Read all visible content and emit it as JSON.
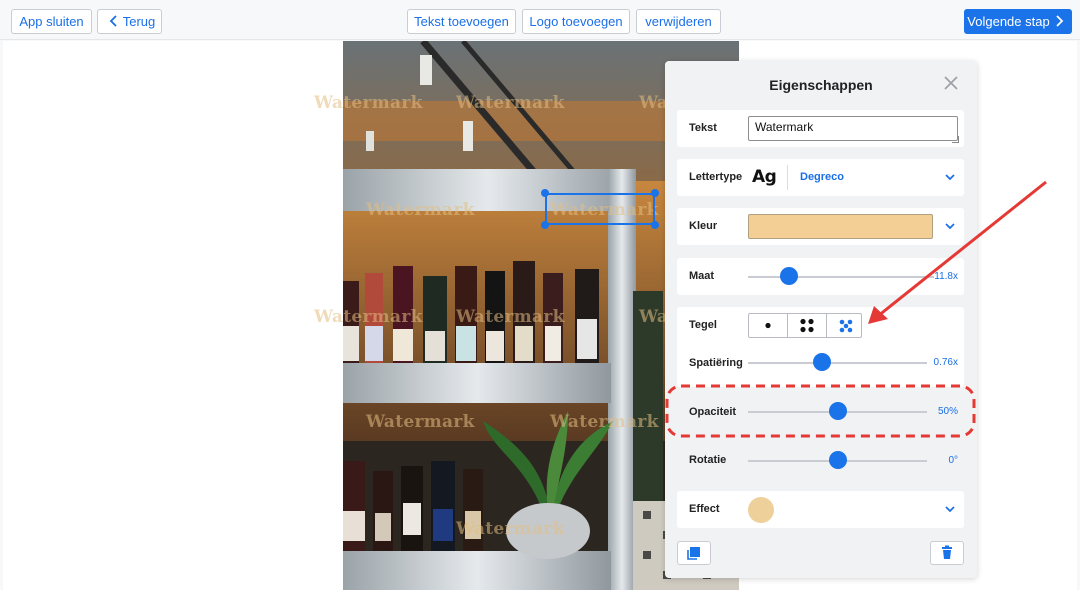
{
  "toolbar": {
    "close_app": "App sluiten",
    "back": "Terug",
    "add_text": "Tekst toevoegen",
    "add_logo": "Logo toevoegen",
    "delete": "verwijderen",
    "next_step": "Volgende stap"
  },
  "canvas": {
    "watermark_text": "Watermark"
  },
  "panel": {
    "title": "Eigenschappen",
    "text_label": "Tekst",
    "text_value": "Watermark",
    "font_label": "Lettertype",
    "font_preview": "Ag",
    "font_name": "Degreco",
    "color_label": "Kleur",
    "color_value": "#f3cf95",
    "size_label": "Maat",
    "size_value": "11.8x",
    "tile_label": "Tegel",
    "spacing_label": "Spatiëring",
    "spacing_value": "0.76x",
    "opacity_label": "Opaciteit",
    "opacity_value": "50%",
    "rotation_label": "Rotatie",
    "rotation_value": "0°",
    "effect_label": "Effect",
    "effect_color": "#eed09a"
  },
  "colors": {
    "accent": "#1a73e8",
    "annotation": "#e53935"
  }
}
